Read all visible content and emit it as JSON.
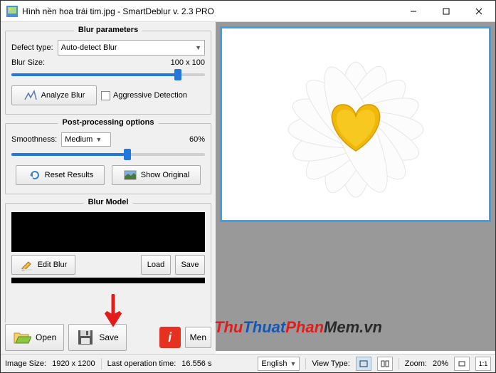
{
  "window": {
    "title": "Hình nền hoa trái tim.jpg - SmartDeblur v. 2.3 PRO"
  },
  "blur_params": {
    "title": "Blur parameters",
    "defect_type_label": "Defect type:",
    "defect_type_value": "Auto-detect Blur",
    "blur_size_label": "Blur Size:",
    "blur_size_value": "100 x 100",
    "analyze_label": "Analyze Blur",
    "aggressive_label": "Aggressive Detection"
  },
  "post": {
    "title": "Post-processing options",
    "smoothness_label": "Smoothness:",
    "smoothness_value": "Medium",
    "smoothness_pct": "60%",
    "reset_label": "Reset Results",
    "show_original_label": "Show Original"
  },
  "blur_model": {
    "title": "Blur Model",
    "edit_label": "Edit Blur",
    "load_label": "Load",
    "save_label": "Save"
  },
  "bottom": {
    "open_label": "Open",
    "save_label": "Save",
    "menu_label": "Men"
  },
  "status": {
    "image_size_label": "Image Size:",
    "image_size_value": "1920 x 1200",
    "last_op_label": "Last operation time:",
    "last_op_value": "16.556 s",
    "view_type_label": "View Type:",
    "zoom_label": "Zoom:",
    "zoom_value": "20%",
    "language_value": "English",
    "fit_label": "1:1"
  },
  "watermark": {
    "t1": "Thu",
    "t2": "Thuat",
    "t3": "Phan",
    "t4": "Mem.vn"
  }
}
